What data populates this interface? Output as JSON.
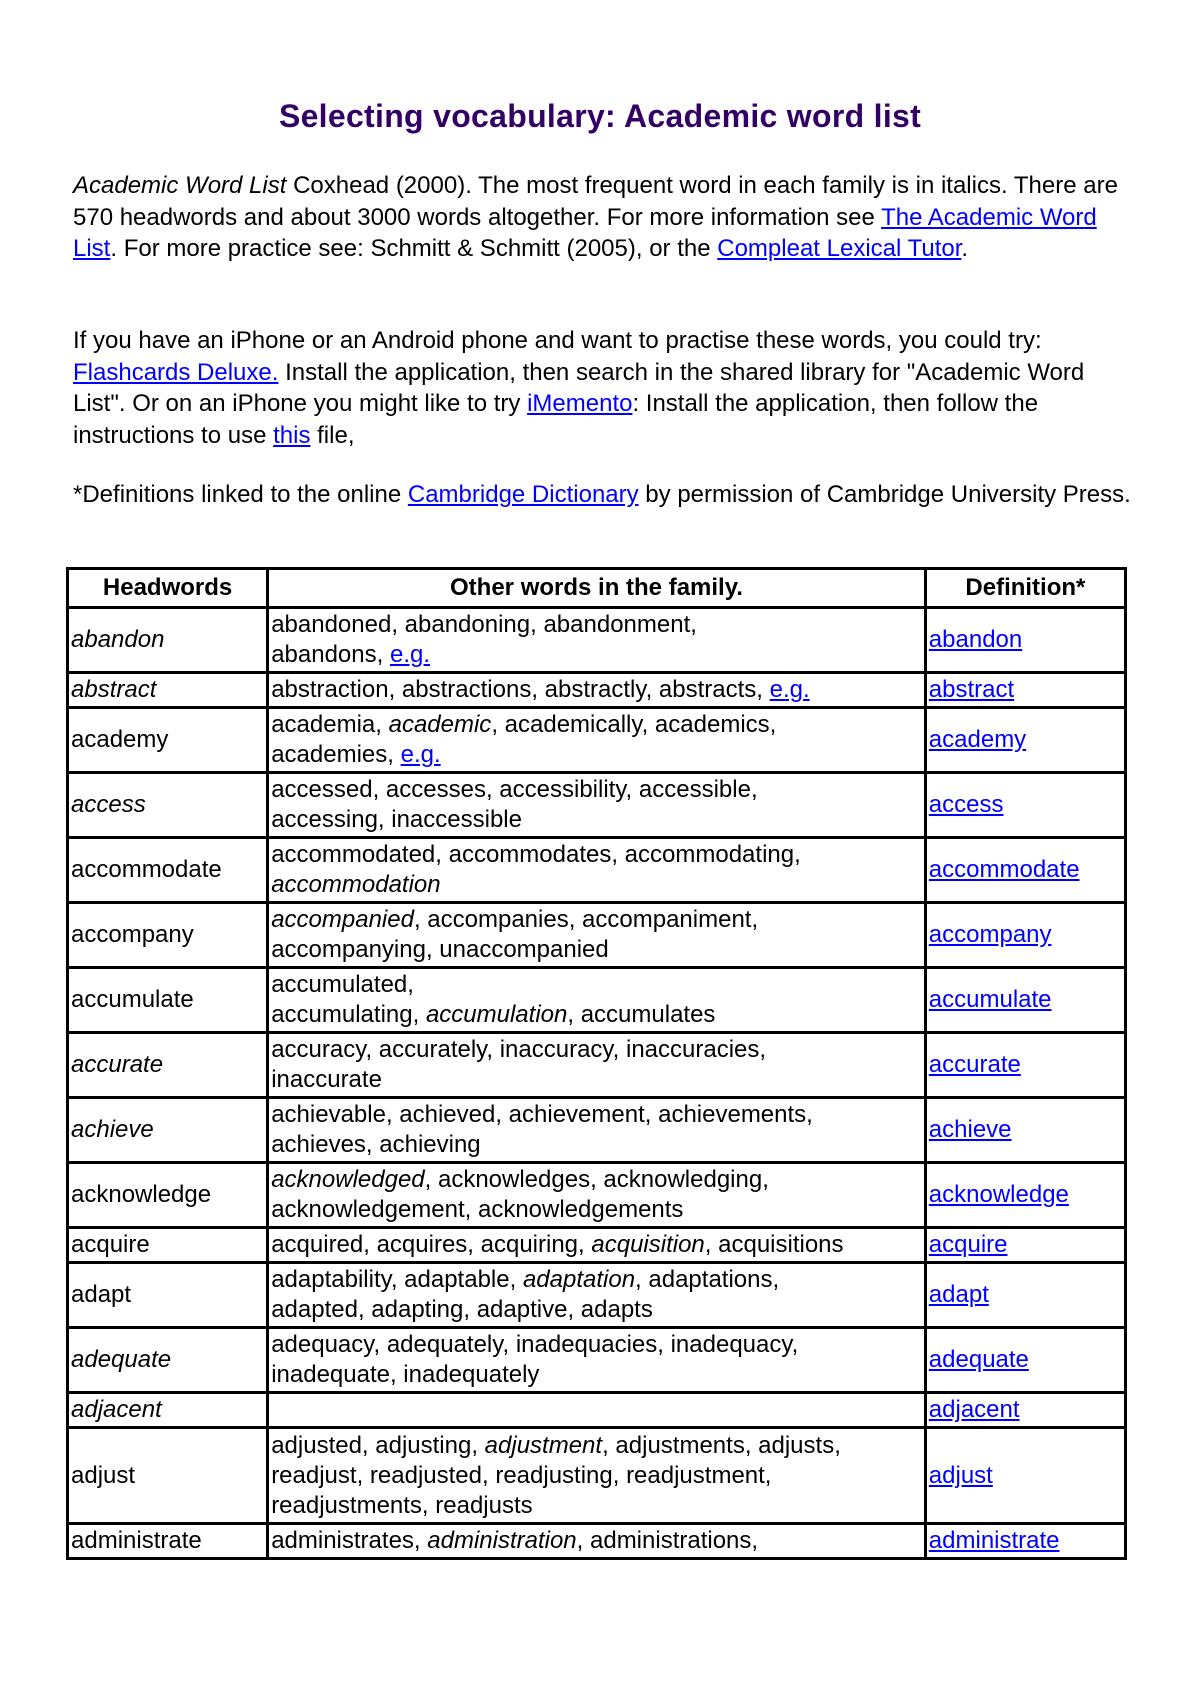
{
  "page": {
    "title": "Selecting vocabulary: Academic word list",
    "title_color": "#330066",
    "link_color": "#0000ff"
  },
  "intro": {
    "p1": {
      "source_italic": "Academic Word List",
      "text1": " Coxhead (2000). The most frequent word in each family is in italics. There are 570 headwords and about 3000 words altogether. For more information see ",
      "link1": "The Academic Word List",
      "text2": ". For more practice see: Schmitt & Schmitt (2005), or the ",
      "link2": "Compleat Lexical Tutor",
      "text3": "."
    },
    "p2": {
      "text1": "If you have an iPhone or an Android phone and want to practise these words, you could try:",
      "link1": " Flashcards Deluxe.",
      "text2": " Install the application, then search in the shared library for \"Academic Word List\". Or on an iPhone you might like to try ",
      "link2": "iMemento",
      "text3": ": Install the application, then follow the instructions to use ",
      "link3": "this",
      "text4": " file,"
    },
    "p3": {
      "text1": "*Definitions linked to the online ",
      "link1": "Cambridge Dictionary",
      "text2": " by permission of Cambridge University Press."
    }
  },
  "table": {
    "headers": [
      "Headwords",
      "Other words in the family.",
      "Definition*"
    ],
    "rows": [
      {
        "headword": "abandon",
        "headword_italic": true,
        "family": [
          {
            "t": "abandoned, abandoning, abandonment, "
          },
          {
            "br": true
          },
          {
            "t": "abandons, "
          },
          {
            "link": "e.g."
          }
        ],
        "definition": "abandon",
        "size": "row1"
      },
      {
        "headword": "abstract",
        "headword_italic": true,
        "family": [
          {
            "t": "abstraction, abstractions, abstractly, abstracts, "
          },
          {
            "link": "e.g."
          }
        ],
        "definition": "abstract",
        "size": "row2"
      },
      {
        "headword": "academy",
        "headword_italic": false,
        "family": [
          {
            "t": "academia, "
          },
          {
            "i": "academic"
          },
          {
            "t": ", academically, academics, "
          },
          {
            "br": true
          },
          {
            "t": "academies, "
          },
          {
            "link": "e.g."
          }
        ],
        "definition": "academy",
        "size": "row1"
      },
      {
        "headword": "access",
        "headword_italic": true,
        "family": [
          {
            "t": "accessed, accesses, accessibility, accessible, "
          },
          {
            "br": true
          },
          {
            "t": "accessing, inaccessible"
          }
        ],
        "definition": "access",
        "size": "row1"
      },
      {
        "headword": "accommodate",
        "headword_italic": false,
        "family": [
          {
            "t": "accommodated, accommodates, accommodating, "
          },
          {
            "br": true
          },
          {
            "i": "accommodation"
          }
        ],
        "definition": "accommodate",
        "size": "row1"
      },
      {
        "headword": "accompany",
        "headword_italic": false,
        "family": [
          {
            "i": "accompanied"
          },
          {
            "t": ", accompanies, accompaniment, "
          },
          {
            "br": true
          },
          {
            "t": "accompanying, unaccompanied"
          }
        ],
        "definition": "accompany",
        "size": "row1"
      },
      {
        "headword": "accumulate",
        "headword_italic": false,
        "family": [
          {
            "t": "accumulated, "
          },
          {
            "br": true
          },
          {
            "t": "accumulating, "
          },
          {
            "i": "accumulation"
          },
          {
            "t": ", accumulates"
          }
        ],
        "definition": "accumulate",
        "size": "row1"
      },
      {
        "headword": "accurate",
        "headword_italic": true,
        "family": [
          {
            "t": "accuracy, accurately, inaccuracy, inaccuracies, "
          },
          {
            "br": true
          },
          {
            "t": "inaccurate"
          }
        ],
        "definition": "accurate",
        "size": "row1"
      },
      {
        "headword": "achieve",
        "headword_italic": true,
        "family": [
          {
            "t": "achievable, achieved, achievement, achievements, "
          },
          {
            "br": true
          },
          {
            "t": "achieves, achieving"
          }
        ],
        "definition": "achieve",
        "size": "row1"
      },
      {
        "headword": "acknowledge",
        "headword_italic": false,
        "family": [
          {
            "i": "acknowledged"
          },
          {
            "t": ", acknowledges, acknowledging, "
          },
          {
            "br": true
          },
          {
            "t": "acknowledgement, acknowledgements"
          }
        ],
        "definition": "acknowledge",
        "size": "row1"
      },
      {
        "headword": "acquire",
        "headword_italic": false,
        "family": [
          {
            "t": "acquired, acquires, acquiring, "
          },
          {
            "i": "acquisition"
          },
          {
            "t": ", acquisitions"
          }
        ],
        "definition": "acquire",
        "size": "row2"
      },
      {
        "headword": "adapt",
        "headword_italic": false,
        "family": [
          {
            "t": "adaptability, adaptable, "
          },
          {
            "i": "adaptation"
          },
          {
            "t": ", adaptations, "
          },
          {
            "br": true
          },
          {
            "t": "adapted, adapting, adaptive, adapts"
          }
        ],
        "definition": "adapt",
        "size": "row1"
      },
      {
        "headword": "adequate",
        "headword_italic": true,
        "family": [
          {
            "t": "adequacy, adequately, inadequacies, inadequacy, "
          },
          {
            "br": true
          },
          {
            "t": "inadequate, inadequately"
          }
        ],
        "definition": "adequate",
        "size": "row1"
      },
      {
        "headword": "adjacent",
        "headword_italic": true,
        "family": [],
        "definition": "adjacent",
        "size": "row2"
      },
      {
        "headword": "adjust",
        "headword_italic": false,
        "family": [
          {
            "t": "adjusted, adjusting, "
          },
          {
            "i": "adjustment"
          },
          {
            "t": ", adjustments, adjusts, "
          },
          {
            "br": true
          },
          {
            "t": "readjust, readjusted, readjusting, readjustment, "
          },
          {
            "br": true
          },
          {
            "t": "readjustments, readjusts"
          }
        ],
        "definition": "adjust",
        "size": "row3"
      },
      {
        "headword": "administrate",
        "headword_italic": false,
        "family": [
          {
            "t": "administrates, "
          },
          {
            "i": "administration"
          },
          {
            "t": ", administrations,"
          }
        ],
        "definition": "administrate",
        "size": "row2"
      }
    ]
  }
}
